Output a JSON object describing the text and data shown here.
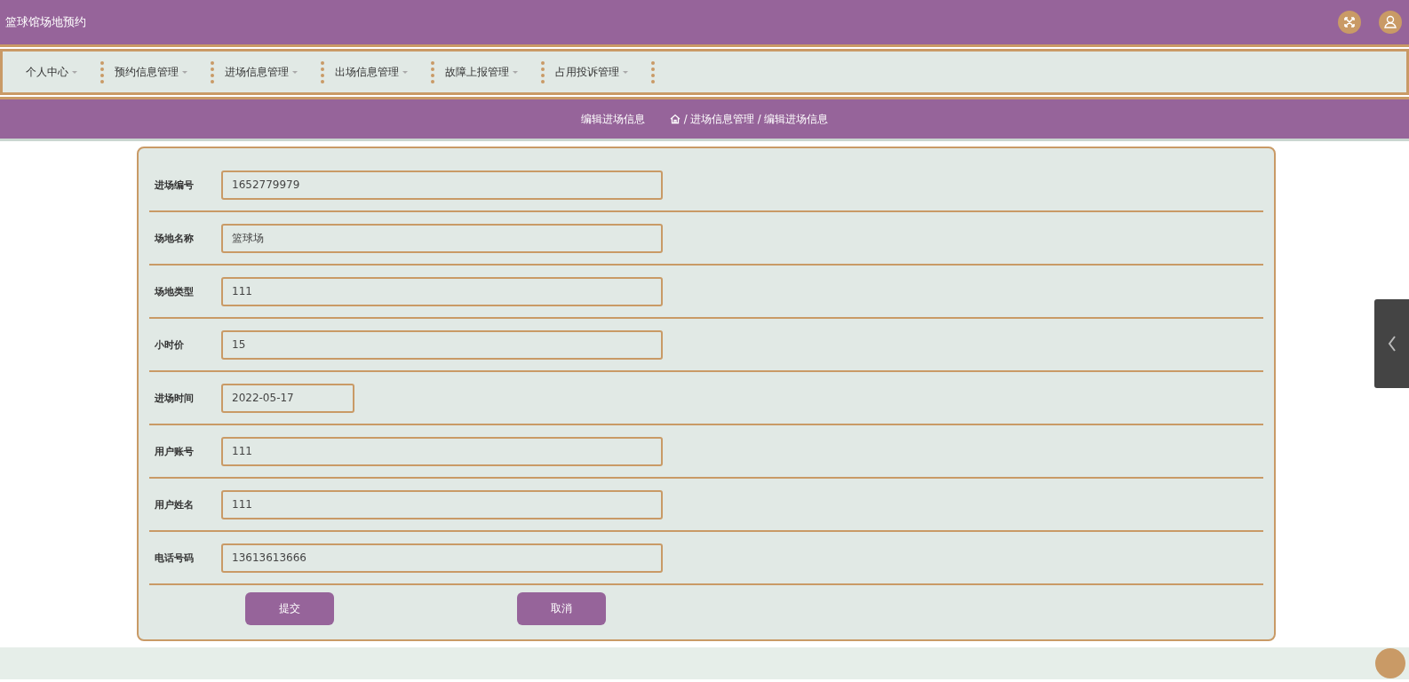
{
  "header": {
    "title": "篮球馆场地预约"
  },
  "nav": {
    "items": [
      {
        "label": "个人中心"
      },
      {
        "label": "预约信息管理"
      },
      {
        "label": "进场信息管理"
      },
      {
        "label": "出场信息管理"
      },
      {
        "label": "故障上报管理"
      },
      {
        "label": "占用投诉管理"
      }
    ]
  },
  "breadcrumb": {
    "title": "编辑进场信息",
    "path": "/ 进场信息管理 / 编辑进场信息"
  },
  "form": {
    "fields": [
      {
        "label": "进场编号",
        "value": "1652779979",
        "kind": "text"
      },
      {
        "label": "场地名称",
        "value": "篮球场",
        "kind": "text"
      },
      {
        "label": "场地类型",
        "value": "111",
        "kind": "text"
      },
      {
        "label": "小时价",
        "value": "15",
        "kind": "text"
      },
      {
        "label": "进场时间",
        "value": "2022-05-17",
        "kind": "date"
      },
      {
        "label": "用户账号",
        "value": "111",
        "kind": "text"
      },
      {
        "label": "用户姓名",
        "value": "111",
        "kind": "text"
      },
      {
        "label": "电话号码",
        "value": "13613613666",
        "kind": "text"
      }
    ],
    "buttons": [
      "提交",
      "取消"
    ]
  }
}
